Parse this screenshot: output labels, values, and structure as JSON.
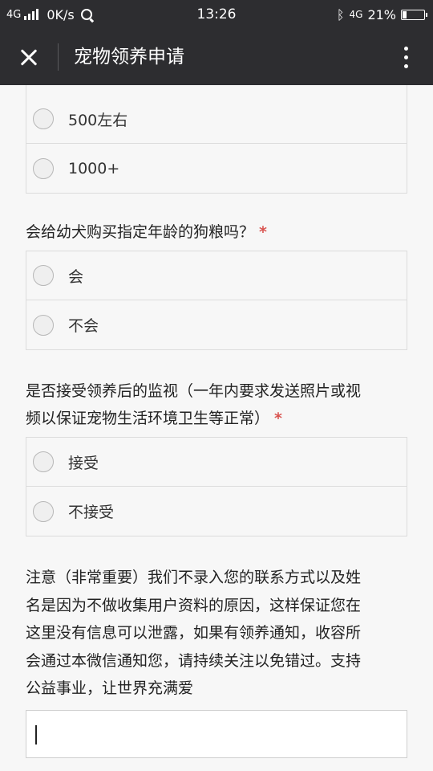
{
  "status_bar": {
    "network": "4G",
    "speed": "0K/s",
    "time": "13:26",
    "network_right": "4G",
    "battery_percent": "21%",
    "battery_level": 0.21
  },
  "app_bar": {
    "title": "宠物领养申请",
    "close_icon": "close-icon",
    "more_icon": "more-vertical-icon"
  },
  "questions": [
    {
      "title": "",
      "options": [
        "500左右",
        "1000+"
      ]
    },
    {
      "title": "会给幼犬购买指定年龄的狗粮吗？",
      "required_mark": "*",
      "options": [
        "会",
        "不会"
      ]
    },
    {
      "title_line1": "是否接受领养后的监视（一年内要求发送照片或视",
      "title_line2": "频以保证宠物生活环境卫生等正常）",
      "required_mark": "*",
      "options": [
        "接受",
        "不接受"
      ]
    }
  ],
  "note": {
    "lines": [
      "注意（非常重要）我们不录入您的联系方式以及姓",
      "名是因为不做收集用户资料的原因，这样保证您在",
      "这里没有信息可以泄露，如果有领养通知，收容所",
      "会通过本微信通知您，请持续关注以免错过。支持",
      "公益事业，让世界充满爱"
    ]
  },
  "text_input": {
    "value": ""
  },
  "colors": {
    "bar_bg": "#2d2d30",
    "page_bg": "#f7f7f7",
    "required": "#d9534f"
  }
}
